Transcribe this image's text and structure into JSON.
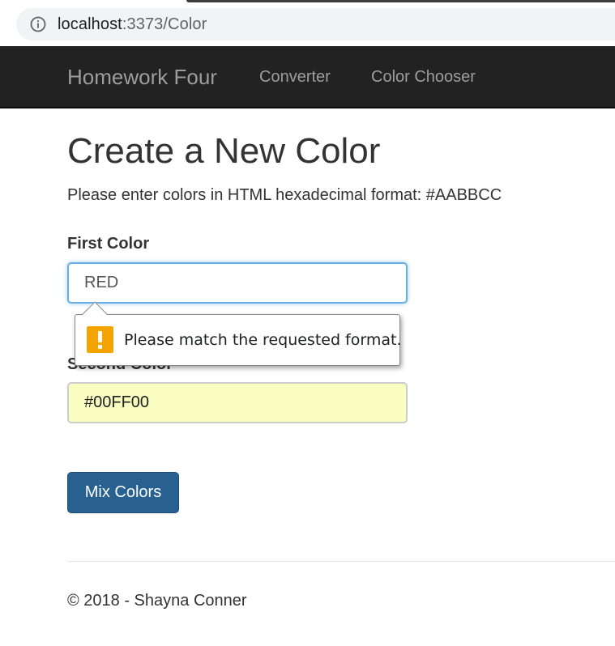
{
  "browser": {
    "url_host": "localhost",
    "url_rest": ":3373/Color"
  },
  "navbar": {
    "brand": "Homework Four",
    "links": [
      "Converter",
      "Color Chooser"
    ]
  },
  "main": {
    "title": "Create a New Color",
    "instructions": "Please enter colors in HTML hexadecimal format: #AABBCC",
    "first_color": {
      "label": "First Color",
      "value": "RED"
    },
    "second_color": {
      "label": "Second Color",
      "value": "#00FF00"
    },
    "validation_message": "Please match the requested format.",
    "submit_label": "Mix Colors"
  },
  "footer": {
    "text": "© 2018 - Shayna Conner"
  },
  "colors": {
    "navbar_bg": "#222222",
    "button_bg": "#286090",
    "focus_border": "#66afe9",
    "autofill_bg": "#fafdc0",
    "warning": "#f5a300"
  },
  "icons": [
    "info-icon",
    "warning-icon"
  ]
}
